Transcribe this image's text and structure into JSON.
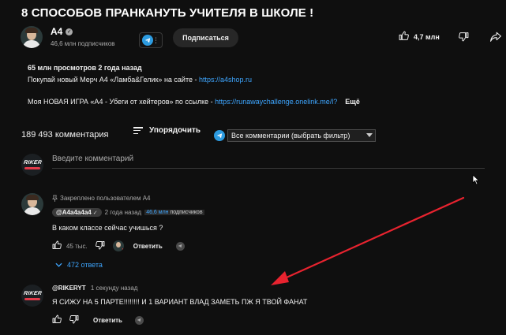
{
  "video": {
    "title": "8 СПОСОБОВ ПРАНКАНУТЬ УЧИТЕЛЯ В ШКОЛЕ !"
  },
  "channel": {
    "name": "A4",
    "subscribers": "46,6 млн подписчиков",
    "subscribe_label": "Подписаться",
    "likes": "4,7 млн"
  },
  "description": {
    "stats": "65 млн просмотров  2 года назад",
    "line1_text": "Покупай новый Мерч А4 «Ламба&Гелик» на сайте - ",
    "line1_link": "https://a4shop.ru",
    "line2_text": "Моя НОВАЯ ИГРА «А4 - Убеги от хейтеров» по ссылке - ",
    "line2_link": "https://runawaychallenge.onelink.me/l?",
    "more_label": "Ещё"
  },
  "comments": {
    "count": "189 493 комментария",
    "sort_label": "Упорядочить",
    "filter_value": "Все комментарии (выбрать фильтр)",
    "add_placeholder": "Введите комментарий",
    "avatar_logo_text": "RIKER",
    "pinned_comment": {
      "pinned_label": "Закреплено пользователем A4",
      "author": "@A4a4a4a4",
      "time": "2 года назад",
      "subs_highlight": "46,6 млн",
      "subs_suffix": " подписчиков",
      "text": "В каком классе сейчас учишься ?",
      "likes": "45 тыс.",
      "reply_label": "Ответить",
      "replies_label": "472 ответа"
    },
    "new_comment": {
      "author": "@RIKERYT",
      "time": "1 секунду назад",
      "text": "Я СИЖУ НА 5 ПАРТЕ!!!!!!!! И 1 ВАРИАНТ ВЛАД ЗАМЕТЬ ПЖ Я ТВОЙ ФАНАТ",
      "reply_label": "Ответить"
    }
  },
  "colors": {
    "background": "#0f0f0f",
    "link": "#3ea6ff",
    "telegram": "#2c9be0",
    "annotation_arrow": "#e8232f"
  }
}
